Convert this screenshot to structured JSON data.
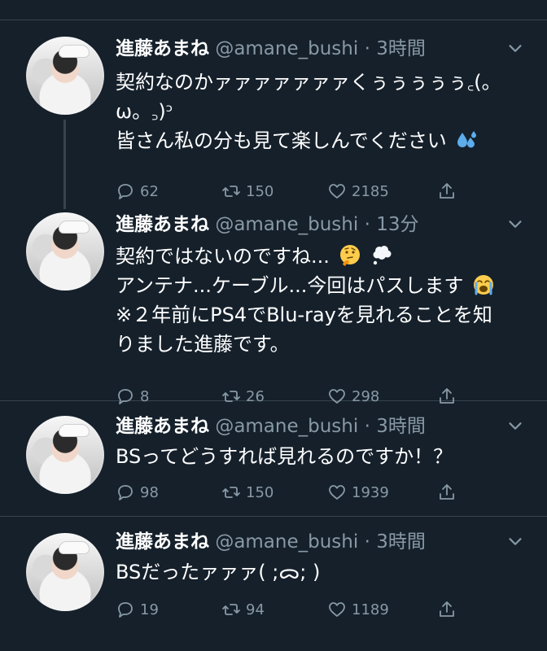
{
  "tweets": [
    {
      "name": "進藤あまね",
      "handle": "@amane_bushi",
      "dot": "·",
      "time": "3時間",
      "lines": [
        "契約なのかァァァァァァァくぅぅぅぅぅ꜀(。",
        "ω。꜆)ᵓ",
        "皆さん私の分も見て楽しんでください"
      ],
      "emoji": "sweat-droplets",
      "reply_count": "62",
      "retweet_count": "150",
      "like_count": "2185"
    },
    {
      "name": "進藤あまね",
      "handle": "@amane_bushi",
      "dot": "·",
      "time": "13分",
      "lines": [
        "契約ではないのですね...",
        "アンテナ...ケーブル...今回はパスします",
        "※２年前にPS4でBlu-rayを見れることを知",
        "りました進藤です。"
      ],
      "emoji": "thinking-face, thought-balloon, crying-face",
      "reply_count": "8",
      "retweet_count": "26",
      "like_count": "298"
    },
    {
      "name": "進藤あまね",
      "handle": "@amane_bushi",
      "dot": "·",
      "time": "3時間",
      "lines": [
        "BSってどうすれば見れるのですか！？"
      ],
      "reply_count": "98",
      "retweet_count": "150",
      "like_count": "1939"
    },
    {
      "name": "進藤あまね",
      "handle": "@amane_bushi",
      "dot": "·",
      "time": "3時間",
      "lines": [
        "BSだったァァァ( ;ᯅ; )"
      ],
      "reply_count": "19",
      "retweet_count": "94",
      "like_count": "1189"
    }
  ],
  "icons": {
    "reply": "reply-icon",
    "retweet": "retweet-icon",
    "like": "heart-icon",
    "share": "share-icon",
    "caret": "chevron-down-icon"
  },
  "colors": {
    "background": "#15202b",
    "divider": "#38444d",
    "secondary_text": "#8899a6",
    "primary_text": "#ffffff"
  }
}
